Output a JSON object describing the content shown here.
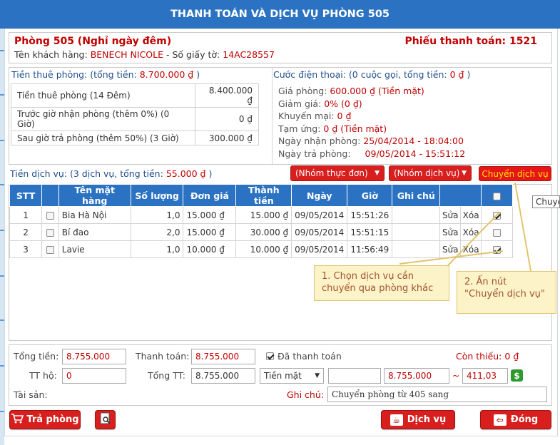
{
  "dialog_title": "THANH TOÁN VÀ DỊCH VỤ PHÒNG 505",
  "room": {
    "title": "Phòng 505 (Nghỉ ngày đêm)",
    "receipt": "Phiếu thanh toán: 1521",
    "customer_label": "Tên khách hàng:",
    "customer_name": "BENECH NICOLE",
    "id_label": "- Số giấy tờ:",
    "id_number": "14AC28557"
  },
  "rent": {
    "heading": "Tiền thuê phòng: (tổng tiền:",
    "total": "8.700.000 ₫",
    "close": ")",
    "rows": [
      {
        "label": "Tiền thuê phòng (14 Đêm)",
        "value": "8.400.000 ₫"
      },
      {
        "label": "Trước giờ nhận phòng (thêm 0%) (0 Giờ)",
        "value": "0 ₫"
      },
      {
        "label": "Sau giờ trả phòng (thêm 50%) (3 Giờ)",
        "value": "300.000 ₫"
      }
    ]
  },
  "phone": {
    "heading": "Cước điện thoại: (0 cuộc gọi, tổng tiền:",
    "total": "0 ₫",
    "close": ")",
    "items": [
      {
        "label": "Giá phòng:",
        "value": "600.000 ₫ (Tiền mặt)"
      },
      {
        "label": "Giảm giá:",
        "value": "0% (0 ₫)"
      },
      {
        "label": "Khuyến mại:",
        "value": "0 ₫"
      },
      {
        "label": "Tạm ứng:",
        "value": "0 ₫ (Tiền mặt)"
      },
      {
        "label": "Ngày nhận phòng:",
        "value": "25/04/2014 - 18:04:00"
      },
      {
        "label": "Ngày trả phòng:",
        "value": "09/05/2014 - 15:51:12"
      }
    ]
  },
  "services": {
    "heading": "Tiền dịch vụ: (3 dịch vụ, tổng tiền:",
    "total": "55.000 ₫",
    "close": ")",
    "menu_group": "(Nhóm thực đơn)",
    "service_group": "(Nhóm dịch vụ)",
    "move_button": "Chuyển dịch vụ",
    "tooltip": "Chuyển dịch vụ",
    "columns": [
      "STT",
      "",
      "Tên mặt hàng",
      "Số lượng",
      "Đơn giá",
      "Thành tiền",
      "Ngày",
      "Giờ",
      "Ghi chú",
      "",
      ""
    ],
    "rows": [
      {
        "stt": "1",
        "name": "Bia Hà Nội",
        "qty": "1,0",
        "price": "15.000 ₫",
        "amount": "15.000 ₫",
        "date": "09/05/2014",
        "time": "15:51:26",
        "note": "",
        "edit": "Sửa",
        "delete": "Xóa",
        "checked": true
      },
      {
        "stt": "2",
        "name": "Bí đao",
        "qty": "2,0",
        "price": "15.000 ₫",
        "amount": "30.000 ₫",
        "date": "09/05/2014",
        "time": "15:51:15",
        "note": "",
        "edit": "Sửa",
        "delete": "Xóa",
        "checked": false
      },
      {
        "stt": "3",
        "name": "Lavie",
        "qty": "1,0",
        "price": "10.000 ₫",
        "amount": "10.000 ₫",
        "date": "09/05/2014",
        "time": "11:56:49",
        "note": "",
        "edit": "Sửa",
        "delete": "Xóa",
        "checked": true
      }
    ]
  },
  "callouts": {
    "first_line1": "1. Chọn  dịch vụ cần",
    "first_line2": "chuyển qua phòng khác",
    "second_line1": "2. Ấn nút",
    "second_line2": "\"Chuyển dịch vụ\""
  },
  "payment": {
    "total_label": "Tổng tiền:",
    "total_value": "8.755.000",
    "pay_label": "Thanh toán:",
    "pay_value": "8.755.000",
    "paid_label": "Đã thanh toán",
    "remaining_label": "Còn thiếu:",
    "remaining_value": "0 ₫",
    "tt_label": "TT hộ:",
    "tt_value": "0",
    "grand_label": "Tổng TT:",
    "grand_value": "8.755.000",
    "method": "Tiền mặt",
    "amount_value": "8.755.000",
    "tilde": "~",
    "usd_value": "411,03",
    "assets_label": "Tài sản:",
    "note_label": "Ghi chú:",
    "note_value": "Chuyển phòng từ 405 sang"
  },
  "footer": {
    "checkout": "Trả phòng",
    "service": "Dịch vụ",
    "close": "Đóng"
  },
  "colors": {
    "header_blue": "#2b73c2",
    "accent_red": "#c00000",
    "button_red": "#d91e1e",
    "callout_bg": "#fdf3c9"
  }
}
